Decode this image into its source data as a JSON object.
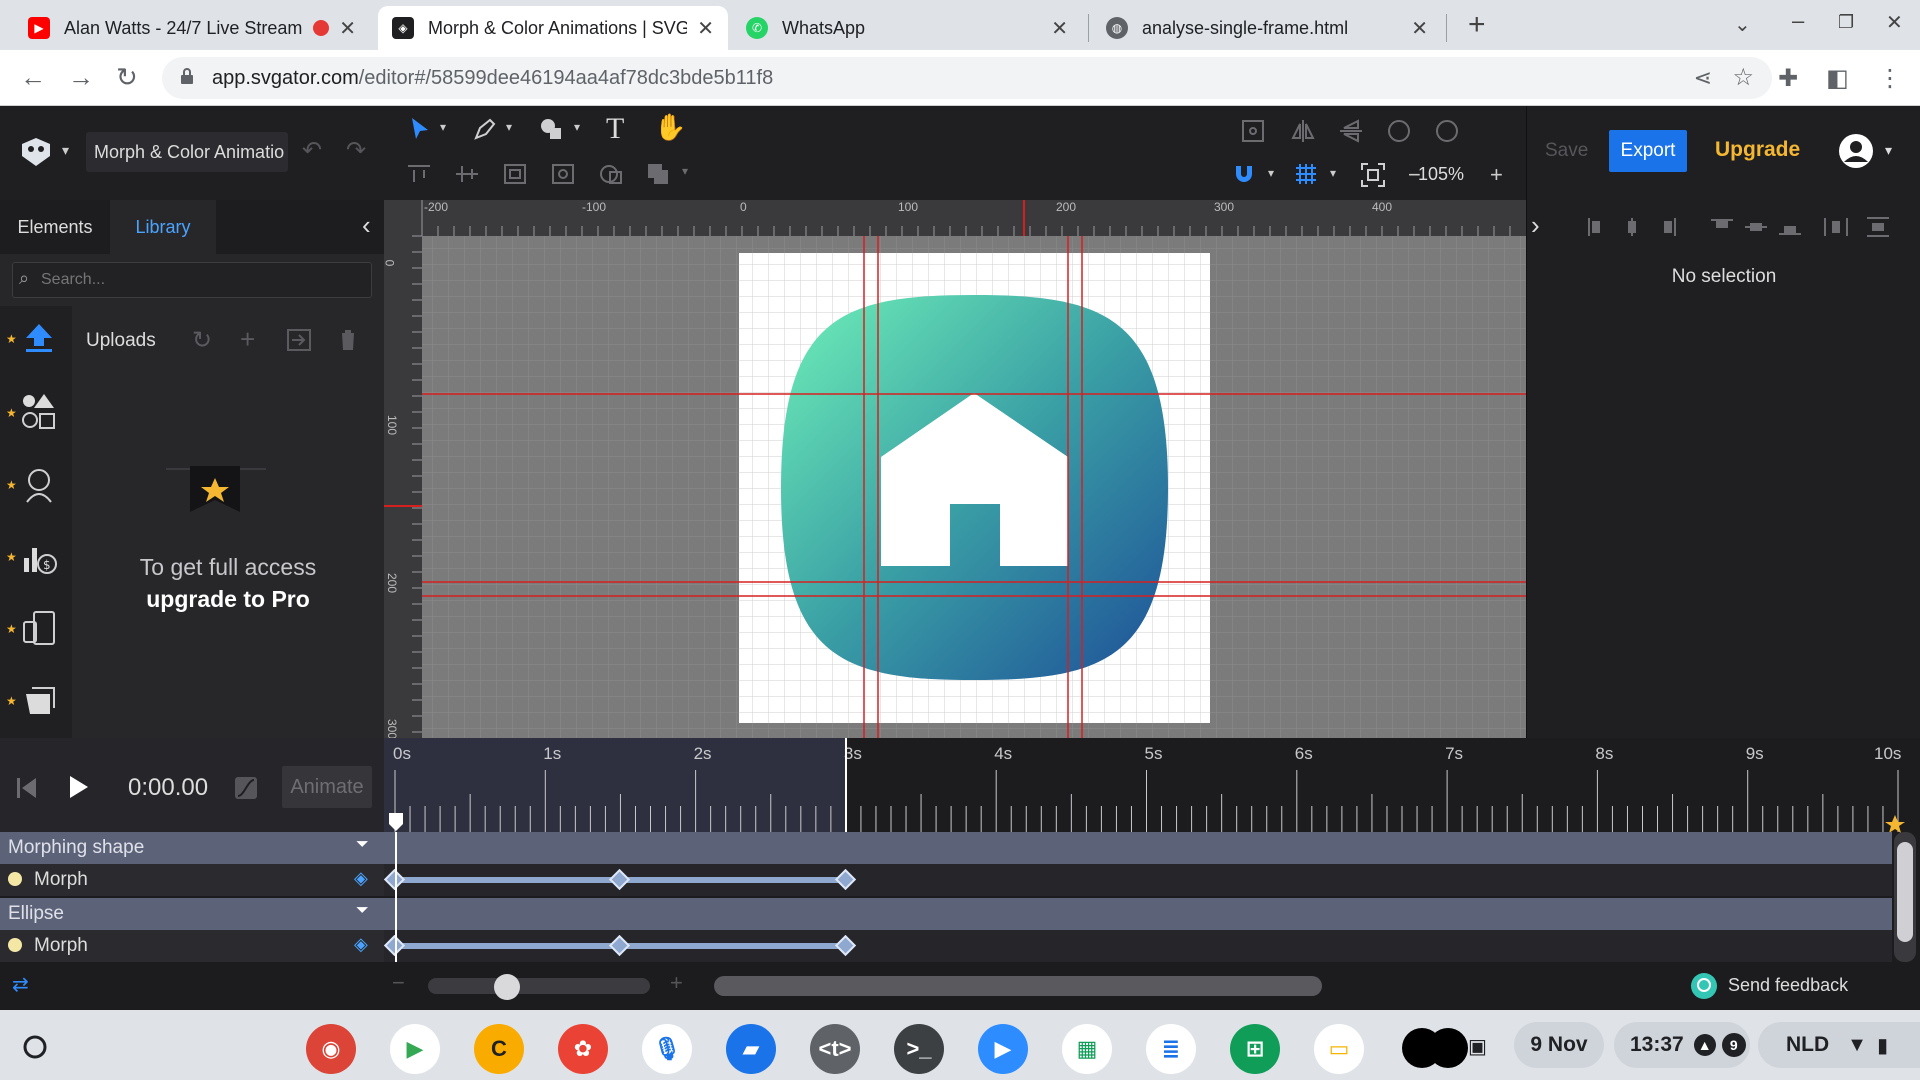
{
  "browser": {
    "tabs": [
      {
        "title": "Alan Watts - 24/7 Live Stream",
        "favicon": "youtube-icon"
      },
      {
        "title": "Morph & Color Animations | SVGator",
        "favicon": "svgator-icon"
      },
      {
        "title": "WhatsApp",
        "favicon": "whatsapp-icon"
      },
      {
        "title": "analyse-single-frame.html",
        "favicon": "globe-icon"
      }
    ],
    "url_host": "app.svgator.com",
    "url_path": "/editor#/58599dee46194aa4af78dc3bde5b11f8"
  },
  "app": {
    "project_name": "Morph & Color Animatio",
    "zoom": "105%",
    "save_label": "Save",
    "export_label": "Export",
    "upgrade_label": "Upgrade",
    "accent": "#1a73e8",
    "upgrade_color": "#f5b731"
  },
  "left_panel": {
    "tabs": [
      "Elements",
      "Library"
    ],
    "active_tab": "Library",
    "search_placeholder": "Search...",
    "uploads_label": "Uploads",
    "upgrade_line1": "To get full access",
    "upgrade_line2": "upgrade to Pro"
  },
  "ruler": {
    "h_labels": [
      "-200",
      "-100",
      "0",
      "100",
      "200",
      "300",
      "400"
    ],
    "v_labels": [
      "0",
      "100",
      "200",
      "300"
    ]
  },
  "right_panel": {
    "no_selection": "No selection"
  },
  "timeline": {
    "time": "0:00.00",
    "animate_label": "Animate",
    "seconds": [
      "0s",
      "1s",
      "2s",
      "3s",
      "4s",
      "5s",
      "6s",
      "7s",
      "8s",
      "9s",
      "10s"
    ],
    "layers": [
      {
        "name": "Morphing shape",
        "property": "Morph",
        "keyframes_s": [
          0,
          1.5,
          3
        ]
      },
      {
        "name": "Ellipse",
        "property": "Morph",
        "keyframes_s": [
          0,
          1.5,
          3
        ]
      }
    ],
    "feedback_label": "Send feedback"
  },
  "shelf": {
    "date": "9 Nov",
    "time": "13:37",
    "notification_count": "9",
    "keyboard": "NLD",
    "apps": [
      {
        "name": "chrome-icon",
        "color": "#db4437"
      },
      {
        "name": "play-store-icon",
        "color": "#ffffff"
      },
      {
        "name": "c-app-icon",
        "color": "#f9ab00",
        "glyph": "C"
      },
      {
        "name": "paint-icon",
        "color": "#ea4335"
      },
      {
        "name": "microphone-icon",
        "color": "#ffffff"
      },
      {
        "name": "files-icon",
        "color": "#1a73e8"
      },
      {
        "name": "code-editor-icon",
        "color": "#5f6368",
        "glyph": "<t>"
      },
      {
        "name": "terminal-icon",
        "color": "#3c4043",
        "glyph": ">_"
      },
      {
        "name": "zoom-icon",
        "color": "#2d8cff"
      },
      {
        "name": "sheets-icon",
        "color": "#ffffff"
      },
      {
        "name": "docs-icon",
        "color": "#ffffff"
      },
      {
        "name": "calculator-icon",
        "color": "#0f9d58"
      },
      {
        "name": "slides-icon",
        "color": "#ffffff"
      }
    ]
  }
}
